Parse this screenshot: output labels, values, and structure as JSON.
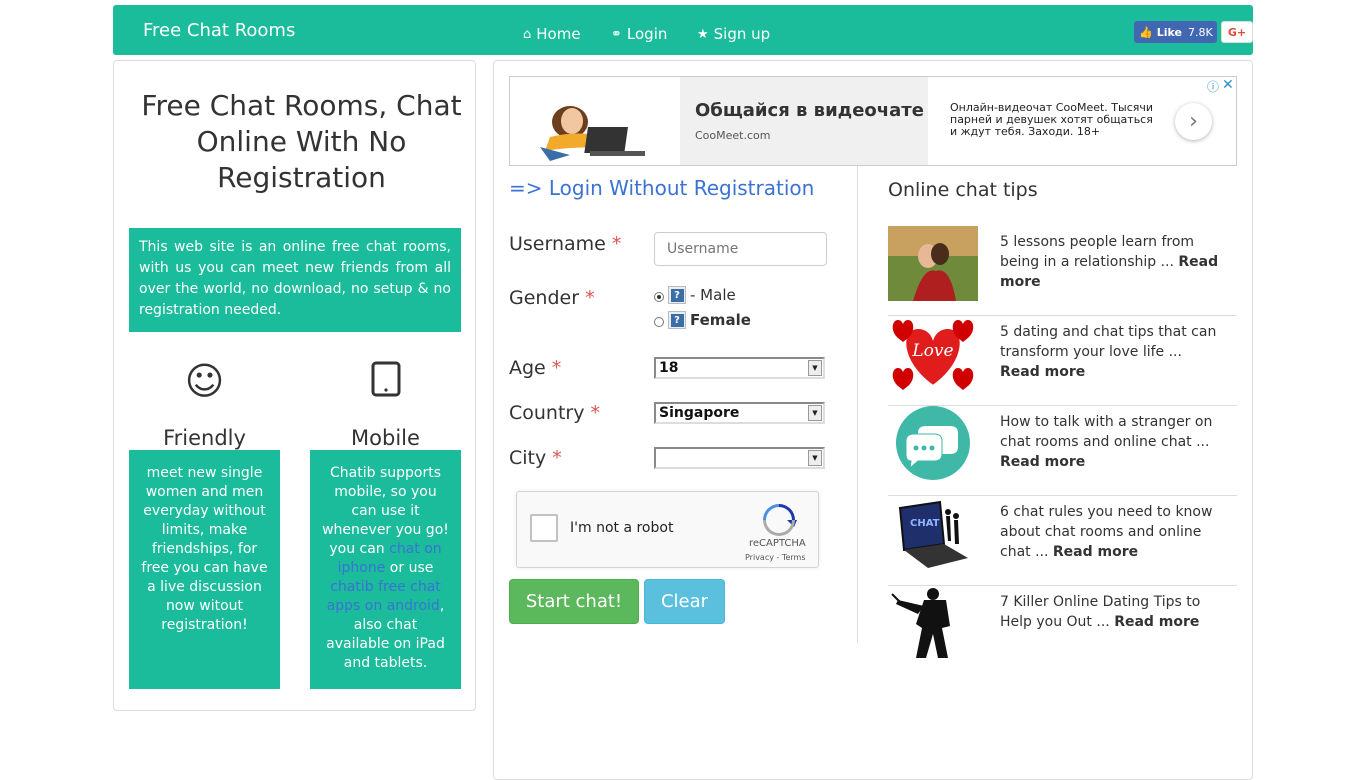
{
  "navbar": {
    "brand": "Free Chat Rooms",
    "links": [
      {
        "icon": "home-icon",
        "label": "Home"
      },
      {
        "icon": "key-icon",
        "label": "Login"
      },
      {
        "icon": "star-icon",
        "label": "Sign up"
      }
    ],
    "fb_like_label": "Like",
    "fb_like_count": "7.8K",
    "gplus_label": "G+"
  },
  "left": {
    "title": "Free Chat Rooms, Chat Online With No Registration",
    "intro": "This web site is an online free chat rooms, with us you can meet new friends from all over the world, no download, no setup & no registration needed.",
    "features": [
      {
        "icon": "smile-icon",
        "title": "Friendly",
        "text": "meet new single women and men everyday without limits, make friendships, for free you can have a live discussion now witout registration!"
      },
      {
        "icon": "tablet-icon",
        "title": "Mobile",
        "text_1": "Chatib supports mobile, so you can use it whenever you go! you can ",
        "link_1": "chat on iphone",
        "text_2": " or use ",
        "link_2": "chatib free chat apps on android",
        "text_3": ", also chat available on iPad and tablets."
      }
    ]
  },
  "ad": {
    "headline": "Общайся в видеочате",
    "domain": "CooMeet.com",
    "description": "Онлайн-видеочат CooMeet. Тысячи парней и девушек хотят общаться и ждут тебя. Заходи. 18+",
    "info_icon": "info-icon",
    "close_icon": "close-icon",
    "arrow_icon": "chevron-right-icon"
  },
  "login": {
    "heading": "=> Login Without Registration",
    "username_label": "Username",
    "username_placeholder": "Username",
    "gender_label": "Gender",
    "gender_options": [
      "- Male",
      "Female"
    ],
    "gender_selected": "- Male",
    "age_label": "Age",
    "age_value": "18",
    "country_label": "Country",
    "country_value": "Singapore",
    "city_label": "City",
    "city_value": "",
    "required_mark": "*",
    "captcha_text": "I'm not a robot",
    "captcha_brand": "reCAPTCHA",
    "captcha_links": "Privacy - Terms",
    "start_button": "Start chat!",
    "clear_button": "Clear"
  },
  "tips": {
    "heading": "Online chat tips",
    "read_more": "Read more",
    "items": [
      {
        "text": "5 lessons people learn from being in a relationship ...",
        "thumb": "couple-photo"
      },
      {
        "text": "5 dating and chat tips that can transform your love life ...",
        "thumb": "love-hearts"
      },
      {
        "text": "How to talk with a stranger on chat rooms and online chat ...",
        "thumb": "chat-bubble"
      },
      {
        "text": "6 chat rules you need to know about chat rooms and online chat ...",
        "thumb": "laptop-chat"
      },
      {
        "text": "7 Killer Online Dating Tips to Help you Out ...",
        "thumb": "soldier-silhouette"
      }
    ]
  },
  "colors": {
    "brand": "#1abc9c",
    "link": "#3b73d4",
    "required": "#d9534f",
    "success": "#5cb85c",
    "info": "#5bc0de"
  }
}
